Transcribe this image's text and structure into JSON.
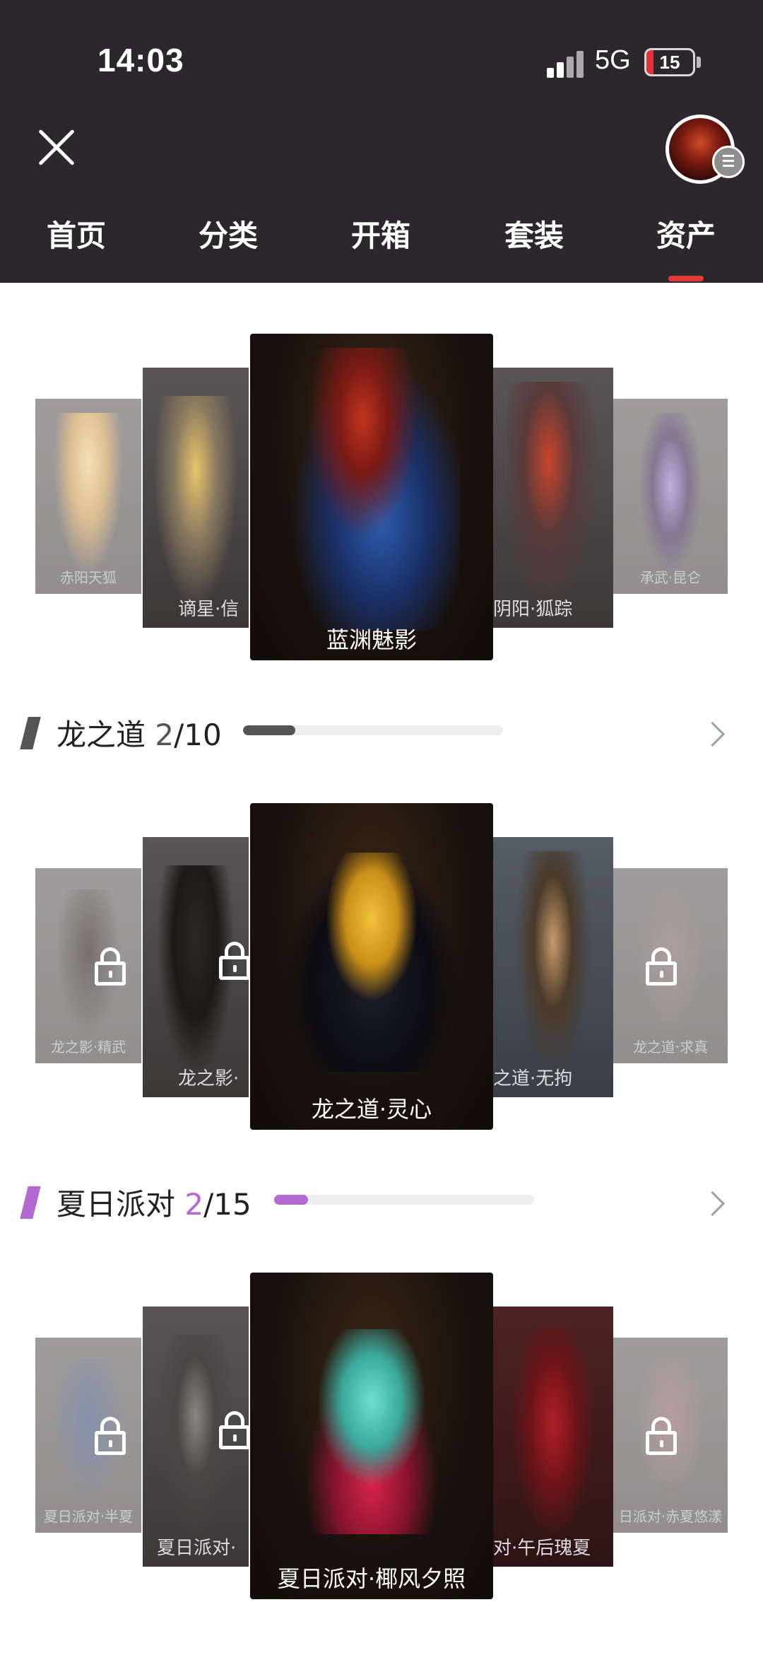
{
  "status_bar": {
    "time": "14:03",
    "network": "5G",
    "battery": "15",
    "battery_level": 0.15
  },
  "tabs": [
    {
      "label": "首页"
    },
    {
      "label": "分类"
    },
    {
      "label": "开箱"
    },
    {
      "label": "套装"
    },
    {
      "label": "资产",
      "active": true
    }
  ],
  "colors": {
    "header_bg": "#2b272c",
    "active_tab": "#e33a3a",
    "dragon_accent": "#555555",
    "summer_accent": "#b26ad1"
  },
  "featured": {
    "cards": [
      {
        "label": "赤阳天狐",
        "locked": false
      },
      {
        "label": "谪星·信",
        "locked": false
      },
      {
        "label": "蓝渊魅影",
        "locked": false,
        "selected": true
      },
      {
        "label": "阴阳·狐踪",
        "locked": false
      },
      {
        "label": "承武·昆仑",
        "locked": false
      }
    ]
  },
  "sections": [
    {
      "title": "龙之道",
      "owned": "2",
      "total": "/10",
      "progress": 0.2,
      "cards": [
        {
          "label": "龙之影·精武",
          "locked": true
        },
        {
          "label": "龙之影·",
          "locked": true
        },
        {
          "label": "龙之道·灵心",
          "locked": false,
          "selected": true
        },
        {
          "label": "之道·无拘",
          "locked": false
        },
        {
          "label": "龙之道·求真",
          "locked": true
        }
      ]
    },
    {
      "title": "夏日派对",
      "owned": "2",
      "total": "/15",
      "progress": 0.13,
      "cards": [
        {
          "label": "夏日派对·半夏",
          "locked": true
        },
        {
          "label": "夏日派对·",
          "locked": true
        },
        {
          "label": "夏日派对·椰风夕照",
          "locked": false,
          "selected": true
        },
        {
          "label": "对·午后瑰夏",
          "locked": false
        },
        {
          "label": "日派对·赤夏悠漾",
          "locked": true
        }
      ]
    }
  ]
}
